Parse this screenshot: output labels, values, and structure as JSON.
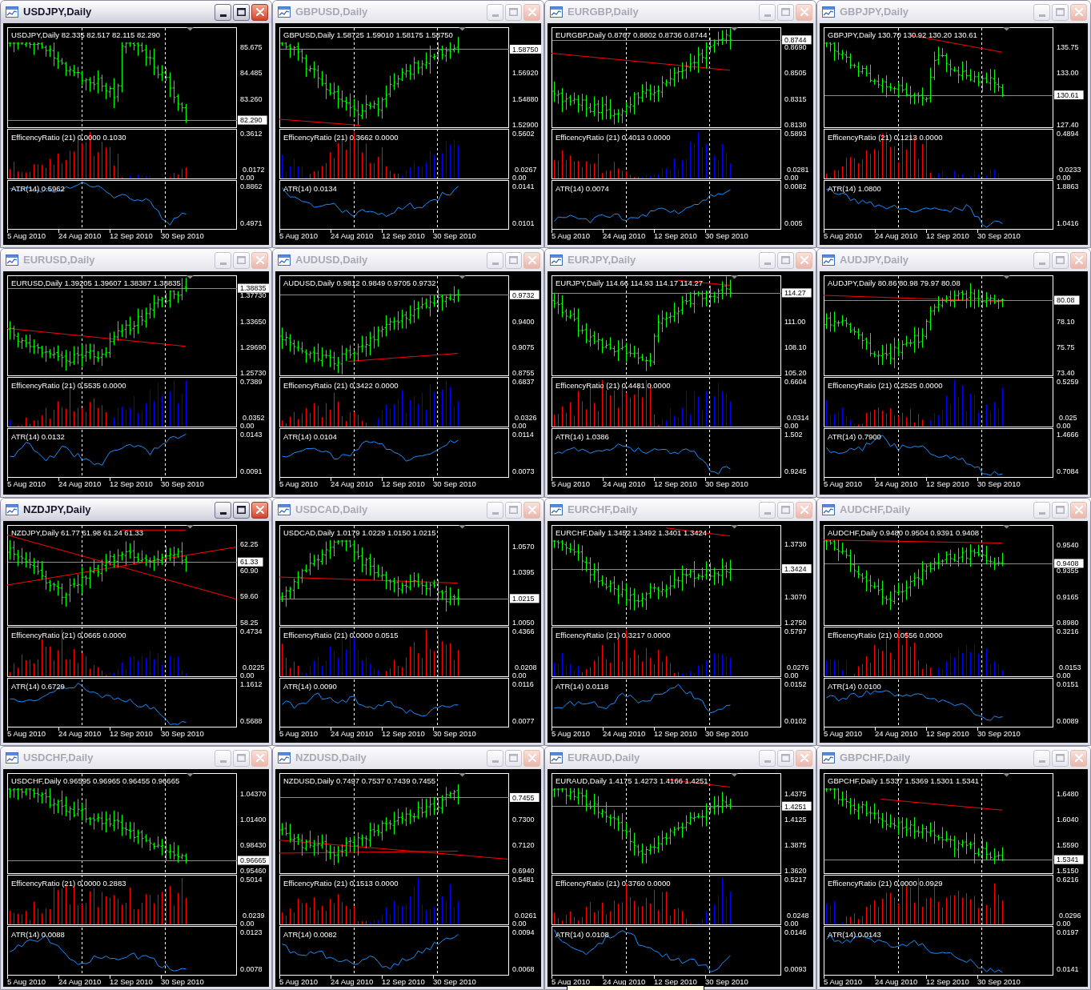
{
  "windows": [
    {
      "title": "USDJPY,Daily",
      "active": true,
      "header": "USDJPY,Daily 82.335 82.517 82.115 82.290",
      "price_ticks": [
        "85.675",
        "84.485",
        "83.260"
      ],
      "last_price": "82.290",
      "efficiency": {
        "label": "EfficencyRatio (21) 0.0000 0.1030",
        "ticks": [
          "0.3612",
          "0.0172",
          "0.00"
        ]
      },
      "atr": {
        "label": "ATR(14) 0.5962",
        "ticks": [
          "0.8862",
          "0.4971"
        ]
      },
      "dates": [
        "5 Aug 2010",
        "24 Aug 2010",
        "12 Sep 2010",
        "30 Sep 2010"
      ]
    },
    {
      "title": "GBPUSD,Daily",
      "active": false,
      "header": "GBPUSD,Daily 1.58725 1.59010 1.58175 1.58750",
      "price_ticks": [
        "1.56920",
        "1.54880",
        "1.52900"
      ],
      "last_price": "1.58750",
      "efficiency": {
        "label": "EfficencyRatio (21) 0.3662 0.0000",
        "ticks": [
          "0.5602",
          "0.0267",
          "0.00"
        ]
      },
      "atr": {
        "label": "ATR(14) 0.0134",
        "ticks": [
          "0.0141",
          "0.0101"
        ]
      },
      "dates": [
        "5 Aug 2010",
        "24 Aug 2010",
        "12 Sep 2010",
        "30 Sep 2010"
      ]
    },
    {
      "title": "EURGBP,Daily",
      "active": false,
      "header": "EURGBP,Daily 0.8767 0.8802 0.8736 0.8744",
      "price_ticks": [
        "0.8690",
        "0.8505",
        "0.8315",
        "0.8130"
      ],
      "last_price": "0.8744",
      "efficiency": {
        "label": "EfficencyRatio (21) 0.4013 0.0000",
        "ticks": [
          "0.5893",
          "0.0281",
          "0.00"
        ]
      },
      "atr": {
        "label": "ATR(14) 0.0074",
        "ticks": [
          "0.0082",
          "0.005"
        ]
      },
      "dates": [
        "5 Aug 2010",
        "24 Aug 2010",
        "12 Sep 2010",
        "30 Sep 2010"
      ]
    },
    {
      "title": "GBPJPY,Daily",
      "active": false,
      "header": "GBPJPY,Daily 130.70 130.92 130.20 130.61",
      "price_ticks": [
        "135.75",
        "133.00",
        "127.40"
      ],
      "last_price": "130.61",
      "efficiency": {
        "label": "EfficencyRatio (21) 0.1213 0.0000",
        "ticks": [
          "0.4894",
          "0.0233",
          "0.00"
        ]
      },
      "atr": {
        "label": "ATR(14) 1.0800",
        "ticks": [
          "1.8863",
          "1.0416"
        ]
      },
      "dates": [
        "5 Aug 2010",
        "24 Aug 2010",
        "12 Sep 2010",
        "30 Sep 2010"
      ]
    },
    {
      "title": "EURUSD,Daily",
      "active": false,
      "header": "EURUSD,Daily 1.39205 1.39607 1.38387 1.38835",
      "price_ticks": [
        "1.37730",
        "1.33650",
        "1.29690",
        "1.25730"
      ],
      "last_price": "1.38835",
      "efficiency": {
        "label": "EfficencyRatio (21) 0.5535 0.0000",
        "ticks": [
          "0.7389",
          "0.0352",
          "0.00"
        ]
      },
      "atr": {
        "label": "ATR(14) 0.0132",
        "ticks": [
          "0.0143",
          "0.0091"
        ]
      },
      "dates": [
        "5 Aug 2010",
        "24 Aug 2010",
        "12 Sep 2010",
        "30 Sep 2010"
      ]
    },
    {
      "title": "AUDUSD,Daily",
      "active": false,
      "header": "AUDUSD,Daily 0.9812 0.9849 0.9705 0.9732",
      "price_ticks": [
        "0.9400",
        "0.9075",
        "0.8755"
      ],
      "last_price": "0.9732",
      "efficiency": {
        "label": "EfficencyRatio (21) 0.3422 0.0000",
        "ticks": [
          "0.6837",
          "0.0326",
          "0.00"
        ]
      },
      "atr": {
        "label": "ATR(14) 0.0104",
        "ticks": [
          "0.0114",
          "0.0073"
        ]
      },
      "dates": [
        "5 Aug 2010",
        "24 Aug 2010",
        "12 Sep 2010",
        "30 Sep 2010"
      ]
    },
    {
      "title": "EURJPY,Daily",
      "active": false,
      "header": "EURJPY,Daily 114.66 114.93 114.17 114.27",
      "price_ticks": [
        "111.00",
        "108.10",
        "105.20"
      ],
      "last_price": "114.27",
      "efficiency": {
        "label": "EfficencyRatio (21) 0.4481 0.0000",
        "ticks": [
          "0.6604",
          "0.0314",
          "0.00"
        ]
      },
      "atr": {
        "label": "ATR(14) 1.0386",
        "ticks": [
          "1.502",
          "0.9245"
        ]
      },
      "dates": [
        "5 Aug 2010",
        "24 Aug 2010",
        "12 Sep 2010",
        "30 Sep 2010"
      ]
    },
    {
      "title": "AUDJPY,Daily",
      "active": false,
      "header": "AUDJPY,Daily 80.86 80.98 79.97 80.08",
      "price_ticks": [
        "78.10",
        "75.75",
        "73.40"
      ],
      "last_price": "80.08",
      "efficiency": {
        "label": "EfficencyRatio (21) 0.2525 0.0000",
        "ticks": [
          "0.5259",
          "0.025",
          "0.00"
        ]
      },
      "atr": {
        "label": "ATR(14) 0.7900",
        "ticks": [
          "1.4666",
          "0.7084"
        ]
      },
      "dates": [
        "5 Aug 2010",
        "24 Aug 2010",
        "12 Sep 2010",
        "30 Sep 2010"
      ]
    },
    {
      "title": "NZDJPY,Daily",
      "active": true,
      "header": "NZDJPY,Daily 61.77 61.98 61.24 61.33",
      "price_ticks": [
        "62.25",
        "60.90",
        "59.60",
        "58.25"
      ],
      "last_price": "61.33",
      "efficiency": {
        "label": "EfficencyRatio (21) 0.0665 0.0000",
        "ticks": [
          "0.4734",
          "0.0225",
          "0.00"
        ]
      },
      "atr": {
        "label": "ATR(14) 0.6729",
        "ticks": [
          "1.1612",
          "0.5688"
        ]
      },
      "dates": [
        "5 Aug 2010",
        "24 Aug 2010",
        "12 Sep 2010",
        "30 Sep 2010"
      ]
    },
    {
      "title": "USDCAD,Daily",
      "active": false,
      "header": "USDCAD,Daily 1.0179 1.0229 1.0150 1.0215",
      "price_ticks": [
        "1.0570",
        "1.0395",
        "1.0050"
      ],
      "last_price": "1.0215",
      "efficiency": {
        "label": "EfficencyRatio (21) 0.0000 0.0515",
        "ticks": [
          "0.4366",
          "0.0208",
          "0.00"
        ]
      },
      "atr": {
        "label": "ATR(14) 0.0090",
        "ticks": [
          "0.0116",
          "0.0077"
        ]
      },
      "dates": [
        "5 Aug 2010",
        "24 Aug 2010",
        "12 Sep 2010",
        "30 Sep 2010"
      ]
    },
    {
      "title": "EURCHF,Daily",
      "active": false,
      "header": "EURCHF,Daily 1.3452 1.3492 1.3401 1.3424",
      "price_ticks": [
        "1.3730",
        "1.3070",
        "1.2750"
      ],
      "last_price": "1.3424",
      "efficiency": {
        "label": "EfficencyRatio (21) 0.3217 0.0000",
        "ticks": [
          "0.5797",
          "0.0276",
          "0.00"
        ]
      },
      "atr": {
        "label": "ATR(14) 0.0118",
        "ticks": [
          "0.0152",
          "0.0102"
        ]
      },
      "dates": [
        "5 Aug 2010",
        "24 Aug 2010",
        "12 Sep 2010",
        "30 Sep 2010"
      ]
    },
    {
      "title": "AUDCHF,Daily",
      "active": false,
      "header": "AUDCHF,Daily 0.9480 0.9504 0.9391 0.9408",
      "price_ticks": [
        "0.9540",
        "0.9355",
        "0.9165",
        "0.8980"
      ],
      "last_price": "0.9408",
      "efficiency": {
        "label": "EfficencyRatio (21) 0.0556 0.0000",
        "ticks": [
          "0.3216",
          "0.0153",
          "0.00"
        ]
      },
      "atr": {
        "label": "ATR(14) 0.0100",
        "ticks": [
          "0.0151",
          "0.0089"
        ]
      },
      "dates": [
        "5 Aug 2010",
        "24 Aug 2010",
        "12 Sep 2010",
        "30 Sep 2010"
      ]
    },
    {
      "title": "USDCHF,Daily",
      "active": false,
      "header": "USDCHF,Daily 0.96595 0.96965 0.96455 0.96665",
      "price_ticks": [
        "1.04370",
        "1.01400",
        "0.98430",
        "0.95460"
      ],
      "last_price": "0.96665",
      "efficiency": {
        "label": "EfficencyRatio (21) 0.0000 0.2883",
        "ticks": [
          "0.5014",
          "0.0239",
          "0.00"
        ]
      },
      "atr": {
        "label": "ATR(14) 0.0088",
        "ticks": [
          "0.0123",
          "0.0078"
        ]
      },
      "dates": [
        "5 Aug 2010",
        "24 Aug 2010",
        "12 Sep 2010",
        "30 Sep 2010"
      ]
    },
    {
      "title": "NZDUSD,Daily",
      "active": false,
      "header": "NZDUSD,Daily 0.7497 0.7537 0.7439 0.7455",
      "price_ticks": [
        "0.7300",
        "0.7120",
        "0.6940"
      ],
      "last_price": "0.7455",
      "efficiency": {
        "label": "EfficencyRatio (21) 0.1513 0.0000",
        "ticks": [
          "0.5481",
          "0.0261",
          "0.00"
        ]
      },
      "atr": {
        "label": "ATR(14) 0.0082",
        "ticks": [
          "0.0094",
          "0.0068"
        ]
      },
      "dates": [
        "5 Aug 2010",
        "24 Aug 2010",
        "12 Sep 2010",
        "30 Sep 2010"
      ]
    },
    {
      "title": "EURAUD,Daily",
      "active": false,
      "header": "EURAUD,Daily 1.4175 1.4273 1.4166 1.4251",
      "price_ticks": [
        "1.4375",
        "1.4125",
        "1.3875",
        "1.3620"
      ],
      "last_price": "1.4251",
      "efficiency": {
        "label": "EfficencyRatio (21) 0.3760 0.0000",
        "ticks": [
          "0.5217",
          "0.0248",
          "0.00"
        ]
      },
      "atr": {
        "label": "ATR(14) 0.0108",
        "ticks": [
          "0.0146",
          "0.0093"
        ]
      },
      "dates": [
        "5 Aug 2010",
        "24 Aug 2010",
        "12 Sep 2010",
        "30 Sep 2010"
      ]
    },
    {
      "title": "GBPCHF,Daily",
      "active": false,
      "header": "GBPCHF,Daily 1.5337 1.5369 1.5301 1.5341",
      "price_ticks": [
        "1.6480",
        "1.6040",
        "1.5590",
        "1.5150"
      ],
      "last_price": "1.5341",
      "efficiency": {
        "label": "EfficencyRatio (21) 0.0000 0.0929",
        "ticks": [
          "0.6216",
          "0.0296",
          "0.00"
        ]
      },
      "atr": {
        "label": "ATR(14) 0.0143",
        "ticks": [
          "0.0197",
          "0.0141"
        ]
      },
      "dates": [
        "5 Aug 2010",
        "24 Aug 2010",
        "12 Sep 2010",
        "30 Sep 2010"
      ]
    }
  ]
}
